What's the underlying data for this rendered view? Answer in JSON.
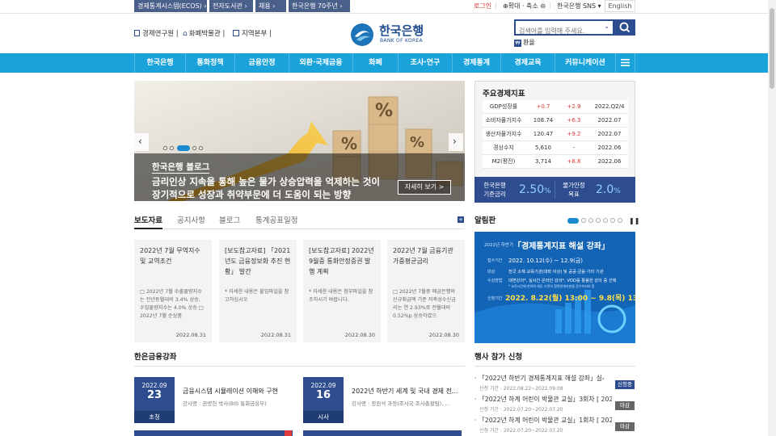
{
  "topbar": {
    "links": [
      "경제통계시스템(ECOS) ›",
      "전자도서관 ›",
      "채용 ›",
      "한국은행 70주년 ›"
    ],
    "login": "로그인",
    "zoom": "⊕확대 · 축소 ⊖",
    "sns": "한국은행 SNS ▾",
    "english": "English"
  },
  "header": {
    "links": [
      "경제연구원",
      "화폐박물관",
      "지역본부"
    ],
    "logo_kr": "한국은행",
    "logo_en": "BANK OF KOREA",
    "search_placeholder": "검색어를 입력해 주세요.",
    "exchange": "환율"
  },
  "nav": {
    "items": [
      "한국은행",
      "통화정책",
      "금융안정",
      "외환·국제금융",
      "화폐",
      "조사·연구",
      "경제통계",
      "경제교육",
      "커뮤니케이션"
    ]
  },
  "slider": {
    "tag": "한국은행 블로그",
    "line1": "금리인상 지속을 통해 높은 물가 상승압력을 억제하는 것이",
    "line2": "장기적으로 성장과 취약부문에 더 도움이 되는 방향",
    "more": "자세히 보기 >"
  },
  "econ": {
    "title": "주요경제지표",
    "rows": [
      {
        "name": "GDP성장률",
        "v1": "+0.7",
        "v2": "+2.9",
        "date": "2022.Q2/4"
      },
      {
        "name": "소비자물가지수",
        "v1": "108.74",
        "v2": "+6.3",
        "date": "2022.07"
      },
      {
        "name": "생산자물가지수",
        "v1": "120.47",
        "v2": "+9.2",
        "date": "2022.07"
      },
      {
        "name": "경상수지",
        "v1": "5,610",
        "v2": "-",
        "date": "2022.06"
      },
      {
        "name": "M2(평잔)",
        "v1": "3,714",
        "v2": "+8.8",
        "date": "2022.06"
      }
    ],
    "base_rate_label1": "한국은행",
    "base_rate_label2": "기준금리",
    "base_rate": "2.50",
    "base_rate_unit": "%",
    "target_label1": "물가안정",
    "target_label2": "목표",
    "target": "2.0",
    "target_unit": "%"
  },
  "tabs": [
    "보도자료",
    "공지사항",
    "블로그",
    "통계공표일정"
  ],
  "cards": [
    {
      "title": "2022년 7월 무역지수 및 교역조건",
      "body": "□ 2022년 7월 수출물량지수는 전년동월대비 3.4% 상승, 수입물량지수는 4.0% 상승 □ 2022년 7월 순상품",
      "date": "2022.08.31"
    },
    {
      "title": "[보도참고자료] 「2021년도 금융정보화 추진 현황」 발간",
      "body": "* 자세한 내용은 붙임파일을 참고하십시오",
      "date": "2022.08.31"
    },
    {
      "title": "[보도참고자료] 2022년 9월중 통화안정증권 발행 계획",
      "body": "* 자세한 내용은 첨부파일을 참조하시기 바랍니다.",
      "date": "2022.08.30"
    },
    {
      "title": "2022년 7월 금융기관 가중평균금리",
      "body": "□ 2022년 7월중 예금은행의 신규취급액 기준 저축성수신금리는 연 2.93%로 전월대비 0.52%p 상승하였으",
      "date": "2022.08.30"
    }
  ],
  "notice": {
    "title": "알림판",
    "banner_small": "2022년 하반기",
    "banner_title": "「경제통계지표 해설 강좌」",
    "period_label": "접수기간",
    "period": "2022. 10.12(수) ~ 12.9(금)",
    "target_label": "대상",
    "target": "전국 소재 교육기관(대학 이상) 및 공공·금융·기타 기관",
    "method_label": "수강방법",
    "method": "대면강의*, 실시간 온라인 강의*, VOD를 활용한 강의 중 선택",
    "note": "* 교육시간에 한하며 해당 기관의 협력관계자분을 준수하셔야 함",
    "apply_label": "신청기간",
    "apply": "2022. 8.22(월) 13:00 ~ 9.8(목) 13:00"
  },
  "lectures": {
    "title": "한은금융강좌",
    "items": [
      {
        "month": "2022.09",
        "day": "23",
        "status": "초청",
        "title": "금융시스템 시뮬레이션 이해와 구현",
        "speaker": "강사명 : 권병헌 박사(BIS 통화금융부)"
      },
      {
        "month": "2022.09",
        "day": "16",
        "status": "시사",
        "title": "2022년 하반기 세계 및 국내 경제 전...",
        "speaker": "강사명 : 정원석 과장(조사국 조사총괄팀), ..."
      }
    ]
  },
  "events": {
    "title": "행사 참가 신청",
    "items": [
      {
        "title": "「2022년 하반기 경제통계지표 해설 강좌」실시",
        "period": "신청 기간 : 2022.08.22~2022.09.08",
        "status": "신청중"
      },
      {
        "title": "「2022년 하계 어린이 박물관 교실」3회차 [ 2022...",
        "period": "신청 기간 : 2022.07.20~2022.07.20",
        "status": "마감"
      },
      {
        "title": "「2022년 하계 어린이 박물관 교실」1회차 [ 2022...",
        "period": "신청 기간 : 2022.07.20~2022.07.20",
        "status": "마감"
      }
    ]
  },
  "colors": {
    "nav": "#19a3da",
    "topbar": "#4a5f8a",
    "navy": "#2e4d8f",
    "red": "#e03a3a"
  }
}
